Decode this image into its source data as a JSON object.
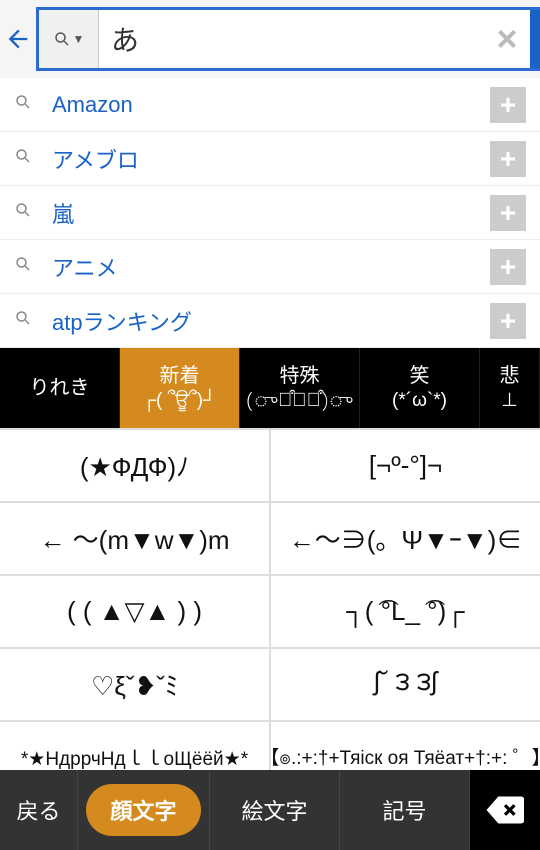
{
  "search": {
    "value": "あ",
    "button_label": "検索",
    "placeholder": ""
  },
  "suggestions": [
    {
      "label": "Amazon"
    },
    {
      "label": "アメブロ"
    },
    {
      "label": "嵐"
    },
    {
      "label": "アニメ"
    },
    {
      "label": "atpランキング"
    }
  ],
  "kao_tabs": [
    {
      "line1": "りれき",
      "line2": "",
      "active": false
    },
    {
      "line1": "新着",
      "line2": "┌( ՞ਊ՞)┘",
      "active": true
    },
    {
      "line1": "特殊",
      "line2": "(ு꒪͒۝꒪͒)ு",
      "active": false
    },
    {
      "line1": "笑",
      "line2": "(*´ω`*)",
      "active": false
    },
    {
      "line1": "悲",
      "line2": "⊥",
      "active": false
    }
  ],
  "kao_grid": [
    "(★ФДФ)ﾉ",
    "[¬º-°]¬",
    "← ～(m▼w▼)m",
    "←～∋(。Ψ▼ｰ▼)∈",
    "(  ( ▲▽▲ )  )",
    "┐( ͡°L_ ͡°)┌",
    "♡ξˇ❥ˇﾐ",
    "ʃ˘ ౩ ౩ʃ",
    "*★НдррчНдｌｌоЩёёй★*",
    "【๏.:+:†+Тяіск оя Тяёат+†:+: ゜】"
  ],
  "bottom_bar": {
    "back": "戻る",
    "kaomoji": "顔文字",
    "emoji": "絵文字",
    "symbols": "記号"
  }
}
